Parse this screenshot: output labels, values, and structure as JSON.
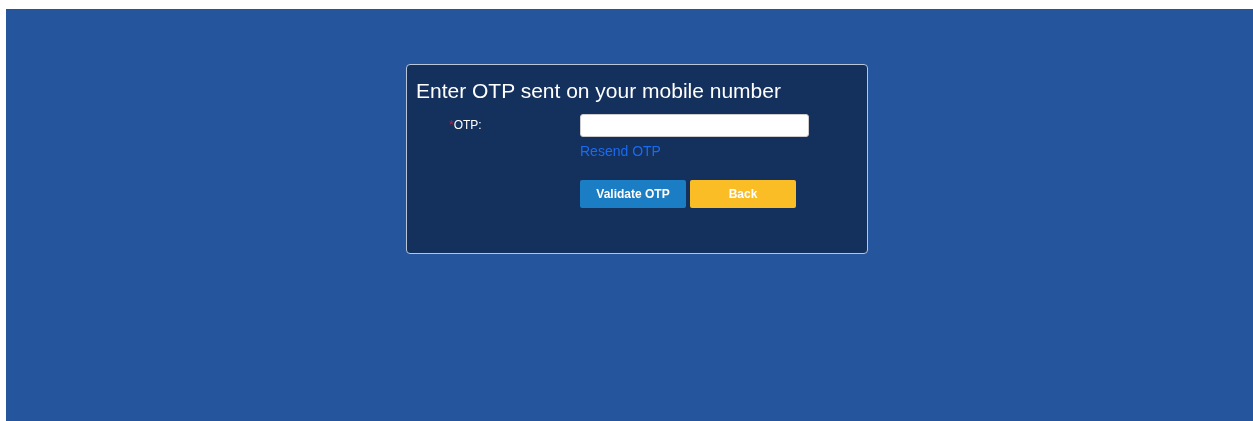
{
  "dialog": {
    "title": "Enter OTP sent on your mobile number",
    "field": {
      "required_mark": "*",
      "label": "OTP:"
    },
    "resend_link": "Resend OTP",
    "buttons": [
      {
        "kind": "primary",
        "label": "Validate OTP"
      },
      {
        "kind": "secondary",
        "label": "Back"
      }
    ]
  }
}
